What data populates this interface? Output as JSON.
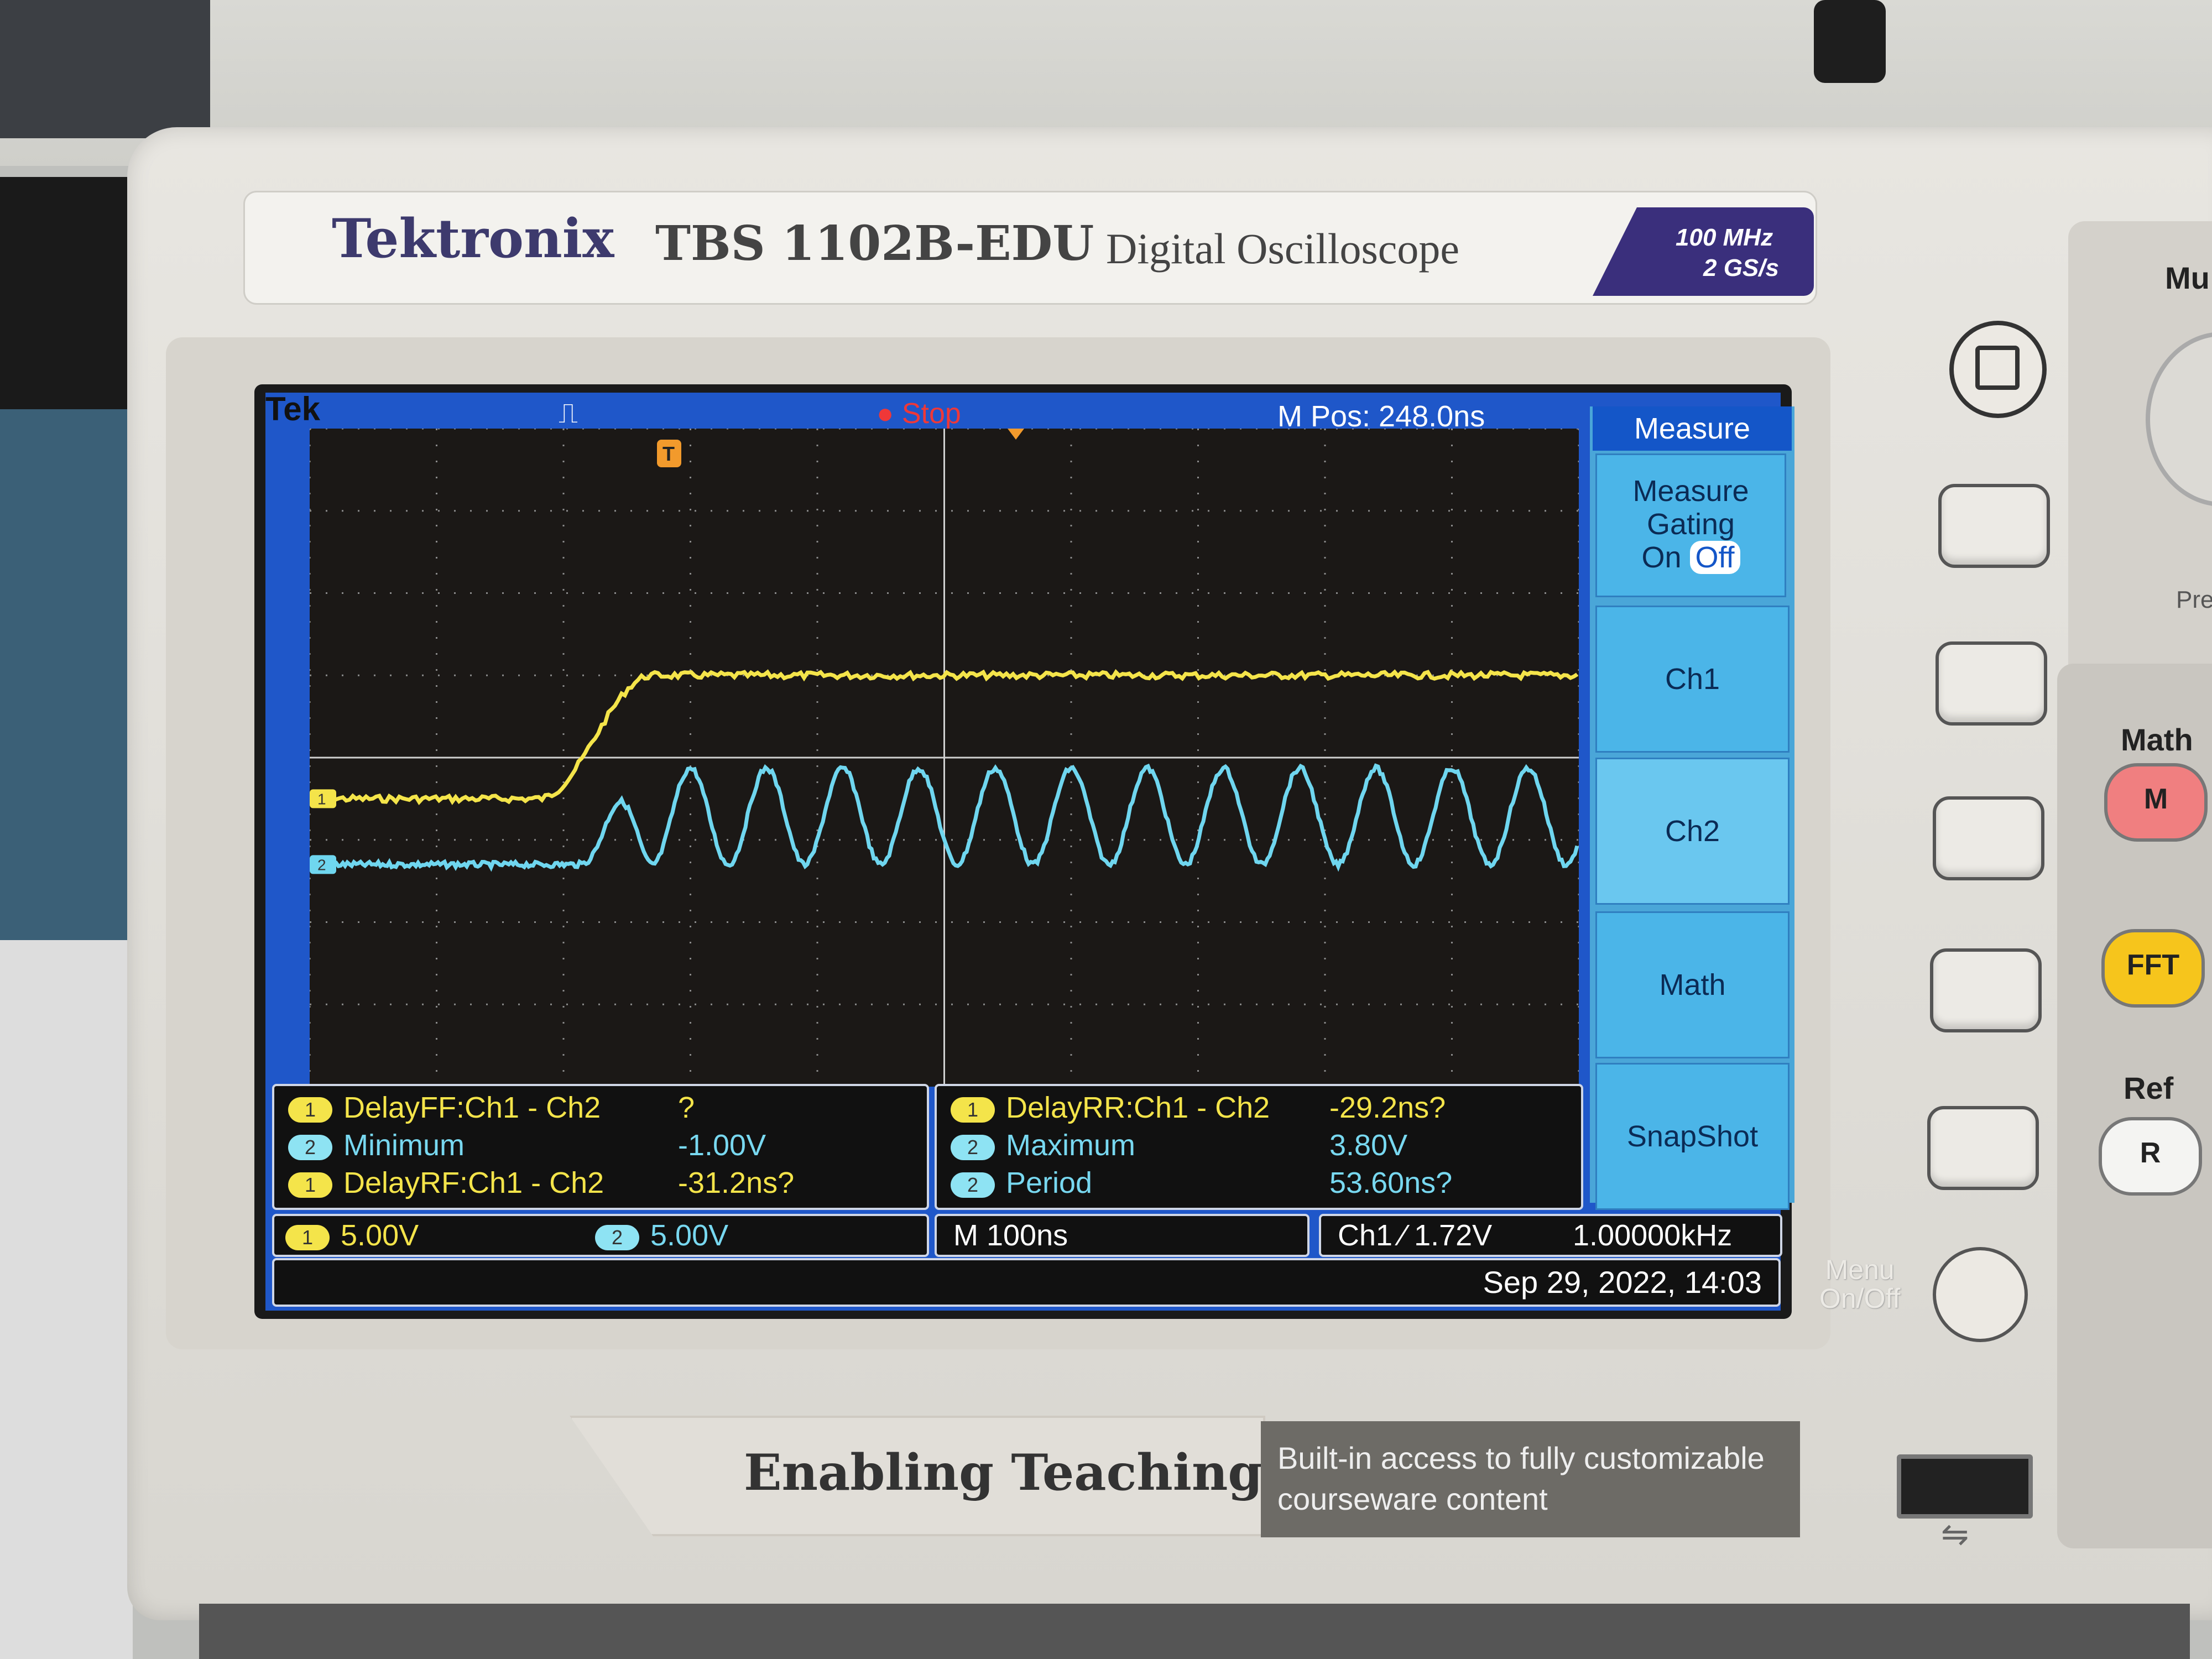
{
  "device": {
    "brand": "Tektronix",
    "model": "TBS 1102B-EDU",
    "description": "Digital Oscilloscope",
    "spec_bandwidth": "100 MHz",
    "spec_samplerate": "2 GS/s"
  },
  "status_bar": {
    "tek": "Tek",
    "acq_icon": "⎍",
    "run_state": "● Stop",
    "mpos": "M Pos: 248.0ns"
  },
  "side_menu": {
    "title": "Measure",
    "gating_line1": "Measure",
    "gating_line2": "Gating",
    "gating_on": "On",
    "gating_off": "Off",
    "item_ch1": "Ch1",
    "item_ch2": "Ch2",
    "item_math": "Math",
    "item_snapshot": "SnapShot"
  },
  "measurements": {
    "left": [
      {
        "ch": "1",
        "name": "DelayFF:Ch1 - Ch2",
        "value": "?"
      },
      {
        "ch": "2",
        "name": "Minimum",
        "value": "-1.00V"
      },
      {
        "ch": "1",
        "name": "DelayRF:Ch1 - Ch2",
        "value": "-31.2ns?"
      }
    ],
    "right": [
      {
        "ch": "1",
        "name": "DelayRR:Ch1 - Ch2",
        "value": "-29.2ns?"
      },
      {
        "ch": "2",
        "name": "Maximum",
        "value": "3.80V"
      },
      {
        "ch": "2",
        "name": "Period",
        "value": "53.60ns?"
      }
    ]
  },
  "scale": {
    "ch1_chip": "1",
    "ch1_volts": "5.00V",
    "ch2_chip": "2",
    "ch2_volts": "5.00V",
    "timebase": "M 100ns",
    "trigger": "Ch1 ⁄ 1.72V",
    "frequency": "1.00000kHz",
    "datetime": "Sep 29, 2022, 14:03"
  },
  "markers": {
    "ch1": "1",
    "ch2": "2",
    "trigger": "T"
  },
  "panel": {
    "multi_label": "Mu",
    "pre_label": "Pre",
    "math_label": "Math",
    "math_button": "M",
    "fft_button": "FFT",
    "ref_label": "Ref",
    "ref_button": "R",
    "menu_onoff_line1": "Menu",
    "menu_onoff_line2": "On/Off"
  },
  "banner": {
    "title": "Enabling Teaching",
    "subtitle": "Built-in access to fully customizable courseware content"
  },
  "colors": {
    "ch1": "#f4e44a",
    "ch2": "#6fd6ef",
    "screen_blue": "#1f57c9",
    "menu_blue": "#4bb5e8"
  },
  "waveforms": {
    "ch1": {
      "baseline_div": -0.5,
      "high_div": 1.0,
      "rise_start_div": 1.8,
      "rise_end_div": 2.7
    },
    "ch2": {
      "baseline_div": -1.3,
      "amplitude_div": 0.9,
      "period_div": 0.6,
      "start_div": 2.1
    }
  }
}
